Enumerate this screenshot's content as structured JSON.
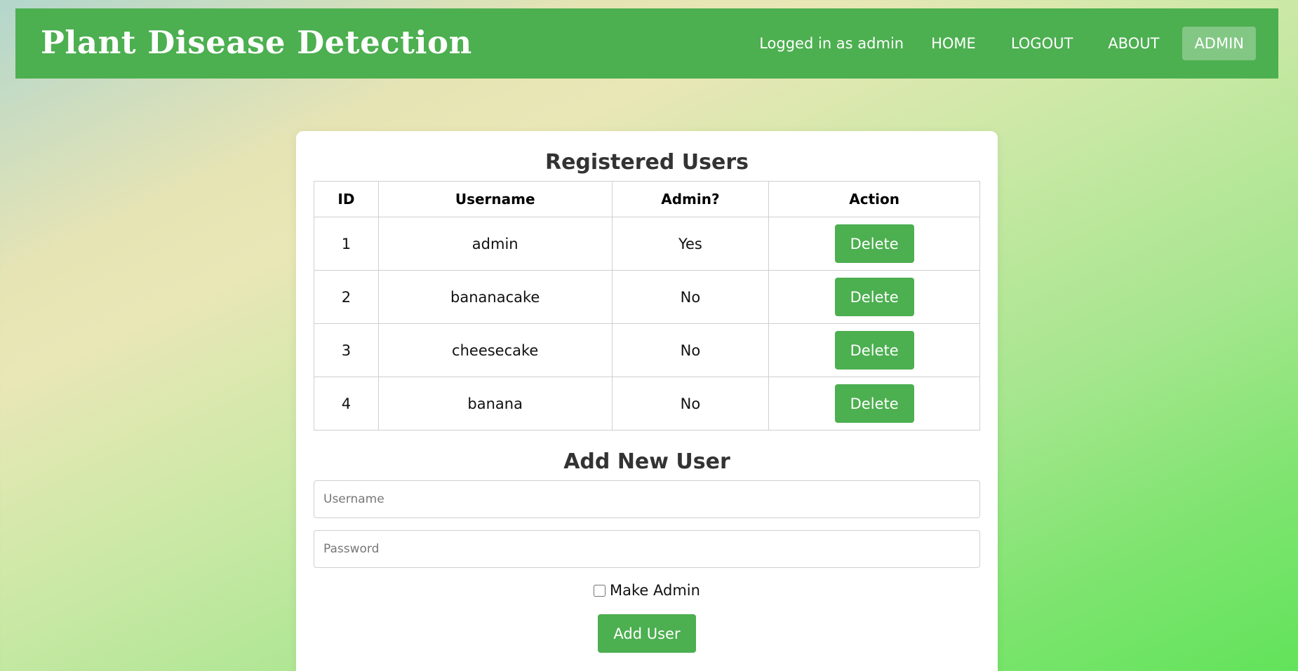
{
  "navbar": {
    "brand": "Plant Disease Detection",
    "logged_in_text": "Logged in as admin",
    "links": [
      "HOME",
      "LOGOUT",
      "ABOUT",
      "ADMIN"
    ],
    "active_link": "ADMIN"
  },
  "users_section": {
    "title": "Registered Users",
    "columns": [
      "ID",
      "Username",
      "Admin?",
      "Action"
    ],
    "rows": [
      {
        "id": "1",
        "username": "admin",
        "admin": "Yes",
        "action": "Delete"
      },
      {
        "id": "2",
        "username": "bananacake",
        "admin": "No",
        "action": "Delete"
      },
      {
        "id": "3",
        "username": "cheesecake",
        "admin": "No",
        "action": "Delete"
      },
      {
        "id": "4",
        "username": "banana",
        "admin": "No",
        "action": "Delete"
      }
    ]
  },
  "add_user_section": {
    "title": "Add New User",
    "username_placeholder": "Username",
    "password_placeholder": "Password",
    "make_admin_label": "Make Admin",
    "make_admin_checked": false,
    "submit_label": "Add User"
  },
  "colors": {
    "primary": "#4caf50",
    "heading": "#333333"
  }
}
